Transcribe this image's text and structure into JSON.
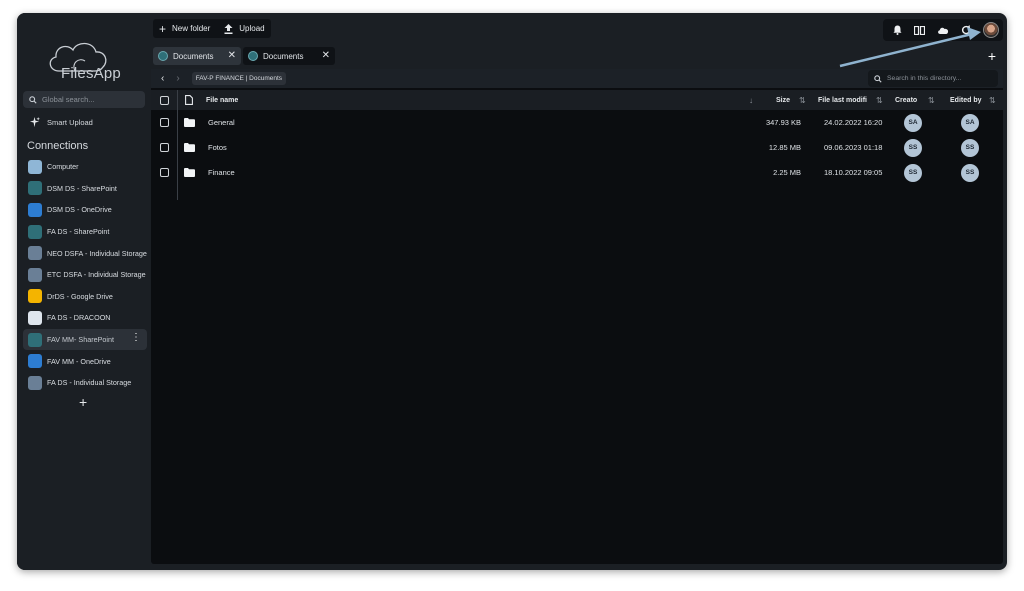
{
  "app": {
    "name": "FilesApp"
  },
  "sidebar": {
    "search_placeholder": "Global search...",
    "smart_upload": "Smart Upload",
    "connections_title": "Connections",
    "connections": [
      {
        "label": "Computer",
        "icon": "computer-icon",
        "color": "#8fb6d6"
      },
      {
        "label": "DSM DS - SharePoint",
        "icon": "sharepoint-icon",
        "color": "#2f6f78"
      },
      {
        "label": "DSM DS - OneDrive",
        "icon": "onedrive-icon",
        "color": "#2d7dd2"
      },
      {
        "label": "FA DS - SharePoint",
        "icon": "sharepoint-icon",
        "color": "#2f6f78"
      },
      {
        "label": "NEO DSFA - Individual Storage",
        "icon": "storage-icon",
        "color": "#6a7f96"
      },
      {
        "label": "ETC DSFA - Individual Storage",
        "icon": "storage-icon",
        "color": "#6a7f96"
      },
      {
        "label": "DrDS - Google Drive",
        "icon": "google-drive-icon",
        "color": "#f4b400"
      },
      {
        "label": "FA DS - DRACOON",
        "icon": "dracoon-icon",
        "color": "#dfe6ee"
      },
      {
        "label": "FAV MM- SharePoint",
        "icon": "sharepoint-icon",
        "color": "#2f6f78",
        "active": true
      },
      {
        "label": "FAV MM - OneDrive",
        "icon": "onedrive-icon",
        "color": "#2d7dd2"
      },
      {
        "label": "FA DS - Individual Storage",
        "icon": "storage-icon",
        "color": "#6a7f96"
      }
    ]
  },
  "toolbar": {
    "new_folder": "New folder",
    "upload": "Upload"
  },
  "tabs": [
    {
      "label": "Documents",
      "active": true
    },
    {
      "label": "Documents",
      "active": false
    }
  ],
  "path": {
    "breadcrumb": "FAV-P FINANCE | Documents",
    "search_placeholder": "Search in this directory..."
  },
  "table": {
    "columns": {
      "name": "File name",
      "size": "Size",
      "modified": "File last modifi",
      "creator": "Creato",
      "edited_by": "Edited by"
    },
    "rows": [
      {
        "name": "General",
        "size": "347.93 KB",
        "modified": "24.02.2022 16:20",
        "creator": "SA",
        "edited_by": "SA"
      },
      {
        "name": "Fotos",
        "size": "12.85 MB",
        "modified": "09.06.2023 01:18",
        "creator": "SS",
        "edited_by": "SS"
      },
      {
        "name": "Finance",
        "size": "2.25 MB",
        "modified": "18.10.2022 09:05",
        "creator": "SS",
        "edited_by": "SS"
      }
    ]
  }
}
